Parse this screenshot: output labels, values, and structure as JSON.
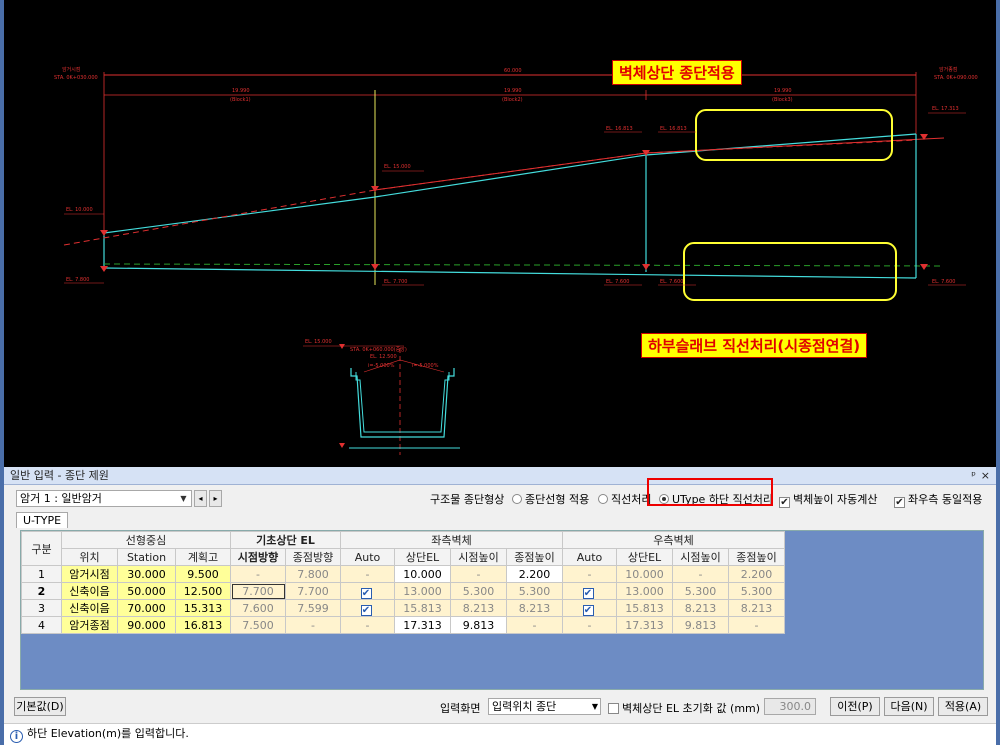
{
  "cad": {
    "callout_top": "벽체상단 종단적용",
    "callout_bottom": "하부슬래브 직선처리(시종점연결)",
    "labels": {
      "start": "암거시점",
      "start_sta": "STA. 0K+030.000",
      "end": "암거종점",
      "end_sta": "STA. 0K+090.000",
      "total": "60.000",
      "seg1": "19.990",
      "seg1_name": "(Block1)",
      "seg2": "19.990",
      "seg2_name": "(Block2)",
      "seg3": "19.990",
      "seg3_name": "(Block3)",
      "el_10": "EL. 10.000",
      "el_7800": "EL. 7.800",
      "el_15": "EL. 15.000",
      "el_7700": "EL. 7.700",
      "el_16813a": "EL. 16.813",
      "el_16813b": "EL. 16.813",
      "el_7600a": "EL. 7.600",
      "el_7600b": "EL. 7.600",
      "el_17313": "EL. 17.313",
      "el_7600c": "EL. 7.600",
      "sec_el15": "EL. 15.000",
      "sec_sta": "STA. 0K+060.000(중앙)",
      "sec_el12": "EL. 12.500",
      "sec_slope_l": "i=-5.000%",
      "sec_slope_r": "i=-5.000%"
    }
  },
  "panel": {
    "title": "일반 입력 - 종단 제원",
    "pin": "ᵖ",
    "close": "×",
    "selector_value": "암거 1 : 일반암거",
    "shape_label": "구조물 종단형상",
    "opt1": "종단선형 적용",
    "opt2": "직선처리",
    "opt3": "UType 하단 직선처리",
    "chk1": "벽체높이 자동계산",
    "chk2": "좌우측 동일적용",
    "tab": "U-TYPE",
    "headers": {
      "gubun": "구분",
      "align": "선형중심",
      "pos": "위치",
      "station": "Station",
      "plan": "계획고",
      "base": "기초상단 EL",
      "base_start": "시점방향",
      "base_end": "종점방향",
      "left": "좌측벽체",
      "right": "우측벽체",
      "auto": "Auto",
      "top_el": "상단EL",
      "start_h": "시점높이",
      "end_h": "종점높이"
    },
    "rows": [
      {
        "no": "1",
        "pos": "암거시점",
        "station": "30.000",
        "plan": "9.500",
        "bs": "-",
        "be": "7.800",
        "l_auto": "-",
        "l_top": "10.000",
        "l_sh": "-",
        "l_eh": "2.200",
        "r_auto": "-",
        "r_top": "10.000",
        "r_sh": "-",
        "r_eh": "2.200"
      },
      {
        "no": "2",
        "pos": "신축이음",
        "station": "50.000",
        "plan": "12.500",
        "bs": "7.700",
        "be": "7.700",
        "l_auto": "✔",
        "l_top": "13.000",
        "l_sh": "5.300",
        "l_eh": "5.300",
        "r_auto": "✔",
        "r_top": "13.000",
        "r_sh": "5.300",
        "r_eh": "5.300"
      },
      {
        "no": "3",
        "pos": "신축이음",
        "station": "70.000",
        "plan": "15.313",
        "bs": "7.600",
        "be": "7.599",
        "l_auto": "✔",
        "l_top": "15.813",
        "l_sh": "8.213",
        "l_eh": "8.213",
        "r_auto": "✔",
        "r_top": "15.813",
        "r_sh": "8.213",
        "r_eh": "8.213"
      },
      {
        "no": "4",
        "pos": "암거종점",
        "station": "90.000",
        "plan": "16.813",
        "bs": "7.500",
        "be": "-",
        "l_auto": "-",
        "l_top": "17.313",
        "l_sh": "9.813",
        "l_eh": "-",
        "r_auto": "-",
        "r_top": "17.313",
        "r_sh": "9.813",
        "r_eh": "-"
      }
    ],
    "btn_default": "기본값(D)",
    "input_screen_label": "입력화면",
    "input_screen_value": "입력위치 종단",
    "init_label": "벽체상단 EL 초기화 값 (mm)",
    "init_value": "300.0",
    "btn_prev": "이전(P)",
    "btn_next": "다음(N)",
    "btn_apply": "적용(A)",
    "status": "하단 Elevation(m)를 입력합니다."
  }
}
